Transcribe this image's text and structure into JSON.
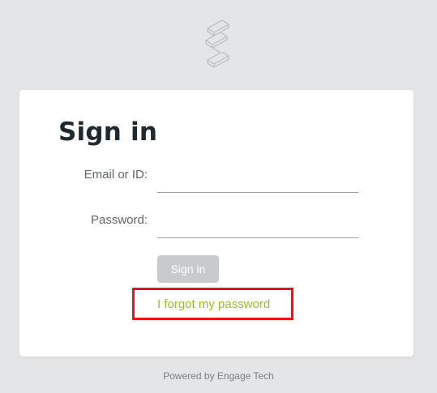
{
  "logo": {
    "icon": "engage-tech-logo-icon"
  },
  "form": {
    "title": "Sign in",
    "email_label": "Email or ID:",
    "email_value": "",
    "password_label": "Password:",
    "password_value": "",
    "signin_label": "Sign in",
    "forgot_label": "I forgot my password"
  },
  "footer": {
    "text": "Powered by Engage Tech"
  },
  "colors": {
    "background": "#e4e5e7",
    "button_disabled": "#c8cbcd",
    "link": "#9cbb2c",
    "highlight": "#e3161e"
  }
}
